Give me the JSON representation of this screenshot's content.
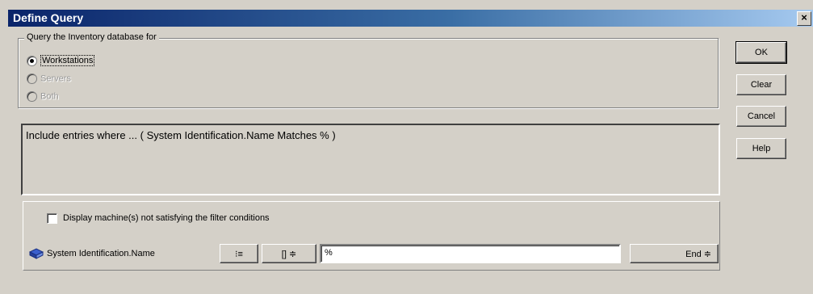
{
  "window": {
    "title": "Define Query",
    "close_glyph": "×"
  },
  "query_group": {
    "legend": "Query the Inventory database for",
    "options": [
      {
        "label": "Workstations",
        "checked": true,
        "enabled": true
      },
      {
        "label": "Servers",
        "checked": false,
        "enabled": false
      },
      {
        "label": "Both",
        "checked": false,
        "enabled": false
      }
    ]
  },
  "filter": {
    "text": "Include entries where ... ( System Identification.Name Matches % )"
  },
  "options": {
    "display_unsatisfied_label": "Display machine(s) not satisfying the filter conditions"
  },
  "condition": {
    "field_label": "System Identification.Name",
    "attribute_button_glyph": "⁝≡",
    "paren_label": "[]",
    "paren_arrows": "≑",
    "value": "%",
    "end_label": "End",
    "end_arrows": "≑"
  },
  "buttons": {
    "ok": "OK",
    "clear": "Clear",
    "cancel": "Cancel",
    "help": "Help"
  }
}
